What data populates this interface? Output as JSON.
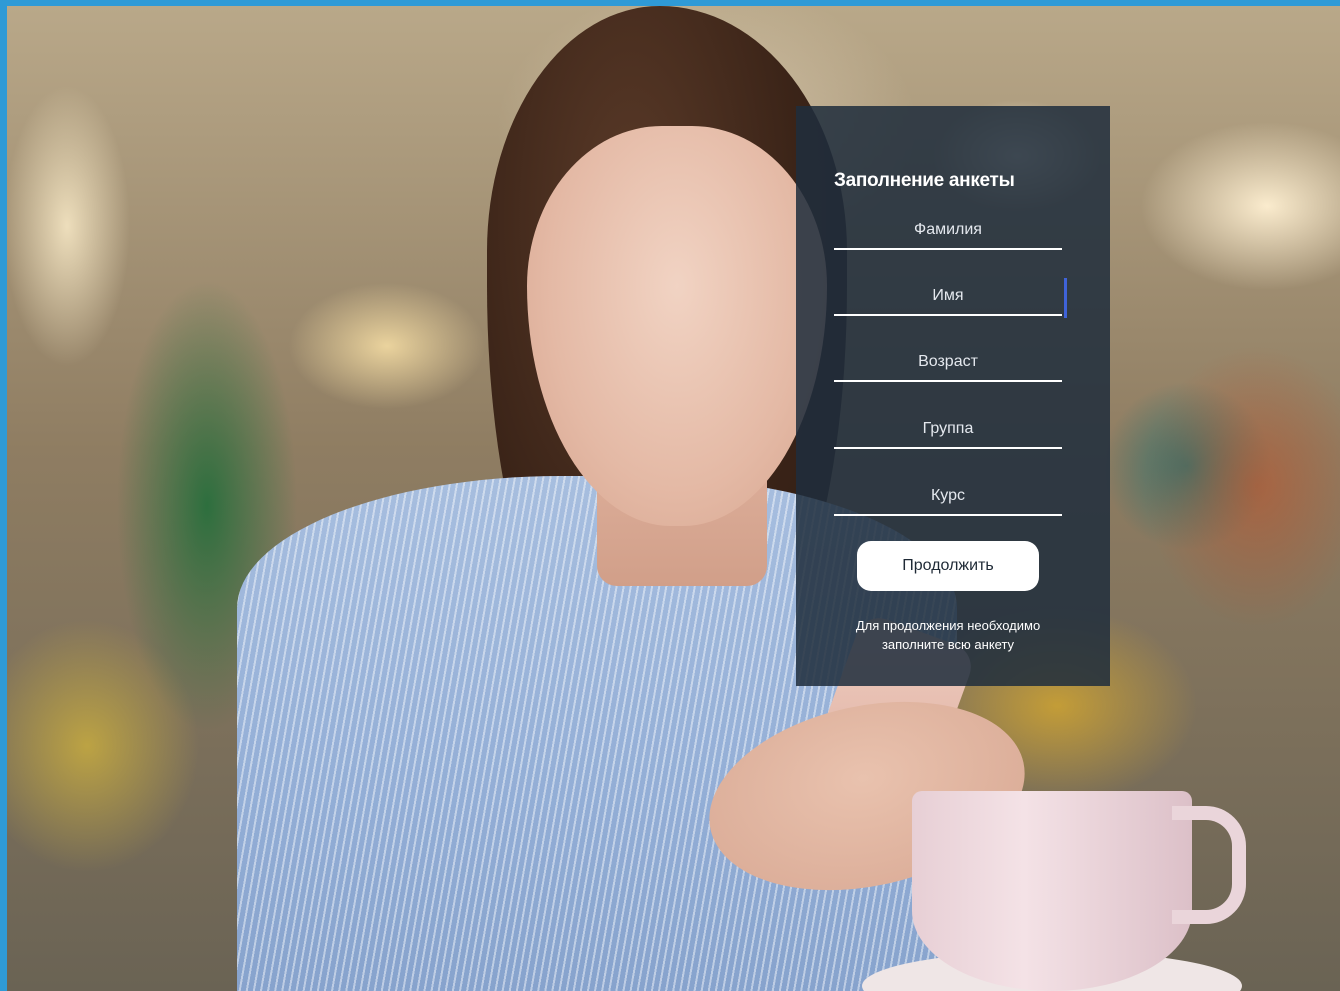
{
  "form": {
    "title": "Заполнение анкеты",
    "fields": [
      {
        "placeholder": "Фамилия",
        "value": ""
      },
      {
        "placeholder": "Имя",
        "value": "",
        "focused": true
      },
      {
        "placeholder": "Возраст",
        "value": ""
      },
      {
        "placeholder": "Группа",
        "value": ""
      },
      {
        "placeholder": "Курс",
        "value": ""
      }
    ],
    "submit_label": "Продолжить",
    "hint_line1": "Для продолжения необходимо",
    "hint_line2": "заполните всю анкету"
  },
  "colors": {
    "frame": "#2f9ad6",
    "panel": "#1f2d3c",
    "focus_indicator": "#3f63d9",
    "button_bg": "#ffffff"
  }
}
